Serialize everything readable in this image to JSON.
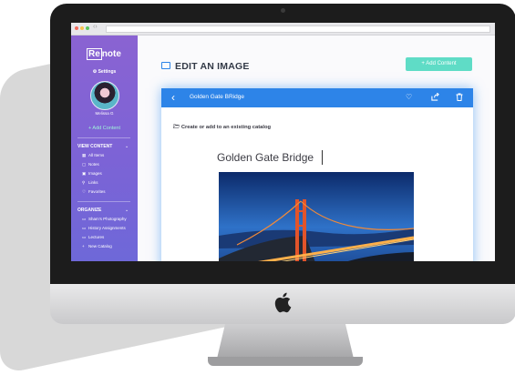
{
  "app": {
    "logo_text": "Re",
    "logo_rest": "note",
    "settings_label": "Settings",
    "user_name": "Melissa G",
    "add_content_sidebar": "+ Add Content"
  },
  "sidebar": {
    "view_content": {
      "heading": "VIEW CONTENT",
      "items": [
        {
          "icon": "grid-icon",
          "glyph": "▦",
          "label": "All Items"
        },
        {
          "icon": "note-icon",
          "glyph": "▢",
          "label": "Notes"
        },
        {
          "icon": "image-icon",
          "glyph": "▣",
          "label": "Images"
        },
        {
          "icon": "link-icon",
          "glyph": "⚲",
          "label": "Links"
        },
        {
          "icon": "heart-icon",
          "glyph": "♡",
          "label": "Favorites"
        }
      ]
    },
    "organize": {
      "heading": "ORGANIZE",
      "items": [
        {
          "icon": "folder-icon",
          "glyph": "▭",
          "label": "Sham's Photography"
        },
        {
          "icon": "folder-icon",
          "glyph": "▭",
          "label": "History Assignments"
        },
        {
          "icon": "folder-icon",
          "glyph": "▭",
          "label": "Lectures"
        },
        {
          "icon": "plus-icon",
          "glyph": "+",
          "label": "New Catalog"
        }
      ]
    }
  },
  "main": {
    "page_title": "EDIT AN IMAGE",
    "add_content_button": "+ Add Content",
    "card": {
      "title": "Golden Gate BRidge",
      "catalog_prompt": "Create or add to an existing catalog",
      "image_name": "Golden Gate Bridge",
      "actions": [
        "heart-icon",
        "share-icon",
        "trash-icon"
      ]
    }
  },
  "colors": {
    "sidebar_top": "#8a63d2",
    "sidebar_bottom": "#6e68d8",
    "accent_blue": "#2d84e8",
    "accent_teal": "#5fdcc6"
  }
}
